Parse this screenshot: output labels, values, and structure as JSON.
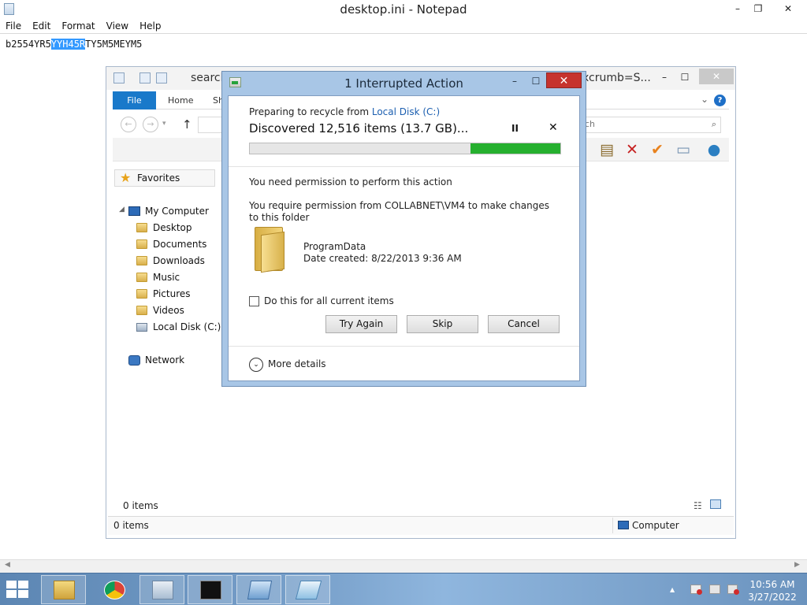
{
  "notepad": {
    "title": "desktop.ini - Notepad",
    "controls": {
      "minimize": "–",
      "restore": "❐",
      "close": "✕"
    },
    "menus": [
      "File",
      "Edit",
      "Format",
      "View",
      "Help"
    ],
    "text_before": "b2554YR5",
    "text_selected": "YYH45R",
    "text_after": "TY5M5MEYM5",
    "scroll_left": "◀",
    "scroll_right": "▶"
  },
  "explorer": {
    "title_left": "search",
    "title_right": "xcrumb=S...",
    "controls": {
      "minimize": "–",
      "maximize": "☐",
      "close": "✕"
    },
    "ribbon_tabs": [
      "File",
      "Home",
      "Sh"
    ],
    "help": "?",
    "nav": {
      "back": "←",
      "forward": "→",
      "recent": "▾",
      "up": "↑"
    },
    "search_text": "ch",
    "favorites": "Favorites",
    "tree": [
      {
        "label": "My Computer",
        "icon": "monitor-icon"
      },
      {
        "label": "Desktop",
        "icon": "folder-icon"
      },
      {
        "label": "Documents",
        "icon": "folder-icon"
      },
      {
        "label": "Downloads",
        "icon": "folder-icon"
      },
      {
        "label": "Music",
        "icon": "folder-icon"
      },
      {
        "label": "Pictures",
        "icon": "folder-icon"
      },
      {
        "label": "Videos",
        "icon": "folder-icon"
      },
      {
        "label": "Local Disk (C:)",
        "icon": "drive-icon"
      },
      {
        "label": "Network",
        "icon": "network-icon"
      }
    ],
    "items_pane": "0 items",
    "status_items": "0 items",
    "status_location": "Computer"
  },
  "dialog": {
    "title": "1 Interrupted Action",
    "controls": {
      "minimize": "–",
      "maximize": "☐",
      "close": "✕"
    },
    "preparing": "Preparing to recycle from ",
    "location_link": "Local Disk (C:)",
    "discovered": "Discovered 12,516 items (13.7 GB)...",
    "pause_icon": "II",
    "cancel_icon": "✕",
    "progress_fraction": 0.29,
    "need_permission": "You need permission to perform this action",
    "require_permission": "You require permission from COLLABNET\\VM4 to make changes to this folder",
    "folder_name": "ProgramData",
    "date_created": "Date created: 8/22/2013 9:36 AM",
    "checkbox_label": "Do this for all current items",
    "checkbox_checked": false,
    "buttons": {
      "try_again": "Try Again",
      "skip": "Skip",
      "cancel": "Cancel"
    },
    "more_details": "More details",
    "more_icon": "⌄"
  },
  "taskbar": {
    "tray_arrow": "▲",
    "tray_icons": [
      "flag-icon",
      "network-icon",
      "volume-icon"
    ],
    "time": "10:56 AM",
    "date": "3/27/2022"
  },
  "colors": {
    "accent": "#1979ca",
    "progress": "#26b02f",
    "close_red": "#c6332e",
    "selection": "#3399ff"
  }
}
